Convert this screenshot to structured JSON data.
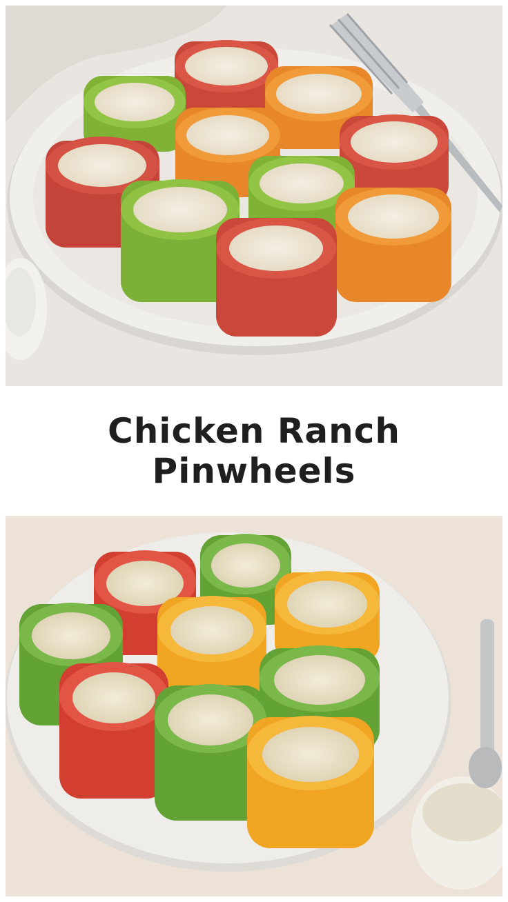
{
  "title": {
    "line1": "Chicken Ranch",
    "line2": "Pinwheels"
  },
  "photos": {
    "top": {
      "subject": "pinwheels-on-plate",
      "colors": [
        "#c9483a",
        "#e8862a",
        "#8fbd3f"
      ]
    },
    "bottom": {
      "subject": "pinwheels-on-plate-with-dip",
      "colors": [
        "#d23f30",
        "#f0a623",
        "#63a336"
      ]
    }
  },
  "colors": {
    "title_text": "#1f1f1f",
    "background": "#ffffff"
  }
}
